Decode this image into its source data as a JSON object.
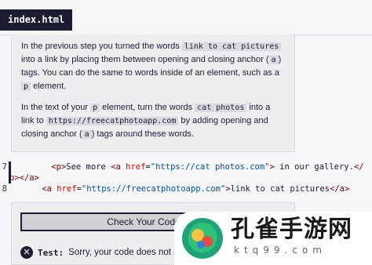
{
  "file_tab": "index.html",
  "instructions": {
    "p1": [
      {
        "t": "text",
        "v": "In the previous step you turned the words "
      },
      {
        "t": "code",
        "v": "link to cat pictures"
      },
      {
        "t": "text",
        "v": " into a link by placing them between opening and closing anchor ("
      },
      {
        "t": "code",
        "v": "a"
      },
      {
        "t": "text",
        "v": ") tags. You can do the same to words inside of an element, such as a "
      },
      {
        "t": "code",
        "v": "p"
      },
      {
        "t": "text",
        "v": " element."
      }
    ],
    "p2": [
      {
        "t": "text",
        "v": "In the text of your "
      },
      {
        "t": "code",
        "v": "p"
      },
      {
        "t": "text",
        "v": " element, turn the words "
      },
      {
        "t": "code",
        "v": "cat photos"
      },
      {
        "t": "text",
        "v": " into a link to "
      },
      {
        "t": "code",
        "v": "https://freecatphotoapp.com"
      },
      {
        "t": "text",
        "v": " by adding opening and closing anchor ("
      },
      {
        "t": "code",
        "v": "a"
      },
      {
        "t": "text",
        "v": ") tags around these words."
      }
    ]
  },
  "editor": {
    "line7_number": "7",
    "line8_number": "8",
    "line7_tokens": [
      {
        "c": "punc",
        "v": "    "
      },
      {
        "c": "tag",
        "v": "<p>"
      },
      {
        "c": "punc",
        "v": "See more "
      },
      {
        "c": "tag",
        "v": "<a"
      },
      {
        "c": "punc",
        "v": " "
      },
      {
        "c": "attr",
        "v": "href"
      },
      {
        "c": "punc",
        "v": "="
      },
      {
        "c": "val",
        "v": "\"https://cat photos.com\""
      },
      {
        "c": "tag",
        "v": ">"
      },
      {
        "c": "punc",
        "v": " in our gallery."
      },
      {
        "c": "tag",
        "v": "</"
      }
    ],
    "line7_wrap_tokens": [
      {
        "c": "tag",
        "v": "p></a>"
      }
    ],
    "line8_tokens": [
      {
        "c": "punc",
        "v": "    "
      },
      {
        "c": "tag",
        "v": "<a"
      },
      {
        "c": "punc",
        "v": " "
      },
      {
        "c": "attr",
        "v": "href"
      },
      {
        "c": "punc",
        "v": "="
      },
      {
        "c": "val",
        "v": "\"https://freecatphotoapp.com\""
      },
      {
        "c": "tag",
        "v": ">"
      },
      {
        "c": "punc",
        "v": "link to cat pictures"
      },
      {
        "c": "tag",
        "v": "</a>"
      }
    ]
  },
  "check_button": "Check Your Code (Ctrl",
  "test": {
    "label": "Test:",
    "message": "Sorry, your code does not pas"
  },
  "watermark": {
    "title": "孔雀手游网",
    "sub": "ktq99.com"
  },
  "colors": {
    "dark": "#1b1b32",
    "tag": "#800000",
    "attr": "#e50000",
    "value": "#0451a5",
    "panel": "#eeeef0"
  }
}
